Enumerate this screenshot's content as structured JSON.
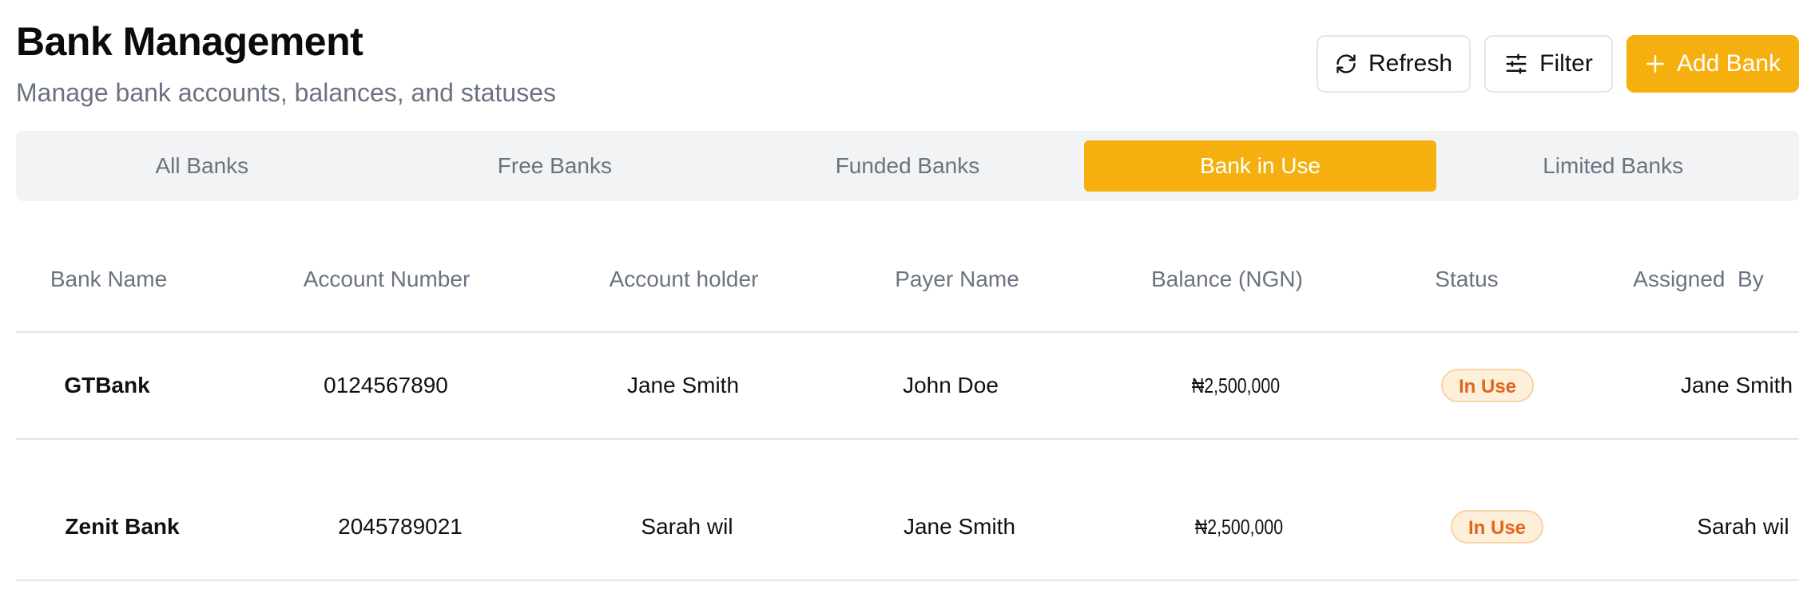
{
  "header": {
    "title": "Bank Management",
    "subtitle": "Manage bank accounts, balances, and statuses"
  },
  "actions": {
    "refresh_label": "Refresh",
    "refresh_icon": "refresh-icon",
    "filter_label": "Filter",
    "filter_icon": "sliders-icon",
    "add_label": "Add Bank",
    "add_icon": "plus-icon"
  },
  "tabs": [
    {
      "label": "All Banks",
      "active": false
    },
    {
      "label": "Free Banks",
      "active": false
    },
    {
      "label": "Funded Banks",
      "active": false
    },
    {
      "label": "Bank in Use",
      "active": true
    },
    {
      "label": "Limited Banks",
      "active": false
    }
  ],
  "table": {
    "columns": [
      "Bank Name",
      "Account Number",
      "Account holder",
      "Payer Name",
      "Balance (NGN)",
      "Status",
      "Assigned  By"
    ],
    "rows": [
      {
        "bank_name": "GTBank",
        "account_number": "0124567890",
        "account_holder": "Jane Smith",
        "payer_name": "John Doe",
        "balance": "₦2,500,000",
        "status": "In Use",
        "assigned_by": "Jane Smith"
      },
      {
        "bank_name": "Zenit Bank",
        "account_number": "2045789021",
        "account_holder": "Sarah wil",
        "payer_name": "Jane Smith",
        "balance": "₦2,500,000",
        "status": "In Use",
        "assigned_by": "Sarah wil"
      }
    ]
  },
  "colors": {
    "accent": "#f5b010",
    "status_text": "#e1661b",
    "status_bg": "#fdefd9",
    "muted_text": "#6b7280"
  }
}
